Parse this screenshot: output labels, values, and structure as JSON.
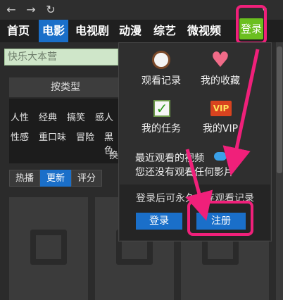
{
  "toolbar": {
    "back_icon": "arrow-left",
    "forward_icon": "arrow-right",
    "refresh_icon": "refresh"
  },
  "nav": {
    "items": [
      "首页",
      "电影",
      "电视剧",
      "动漫",
      "综艺",
      "微视频"
    ],
    "active": "电影",
    "login_label": "登录"
  },
  "search": {
    "value": "快乐大本营"
  },
  "category": {
    "header": "按类型",
    "row1": [
      "人性",
      "经典",
      "搞笑",
      "感人"
    ],
    "row2": [
      "性感",
      "重口味",
      "冒险",
      "黑色"
    ],
    "more": "换"
  },
  "sort_tabs": [
    "热播",
    "更新",
    "评分"
  ],
  "sort_active": "更新",
  "panel": {
    "history_label": "观看记录",
    "favorites_label": "我的收藏",
    "tasks_label": "我的任务",
    "vip_label": "我的VIP",
    "vip_badge": "VIP",
    "recent_title": "最近观看的视频",
    "recent_empty": "您还没有观看任何影片",
    "login_prompt": "登录后可永久保存观看记录",
    "login_button": "登录",
    "register_button": "注册"
  },
  "colors": {
    "accent_blue": "#1a6fc9",
    "login_green": "#6bbf1f",
    "highlight_pink": "#f0207a"
  }
}
